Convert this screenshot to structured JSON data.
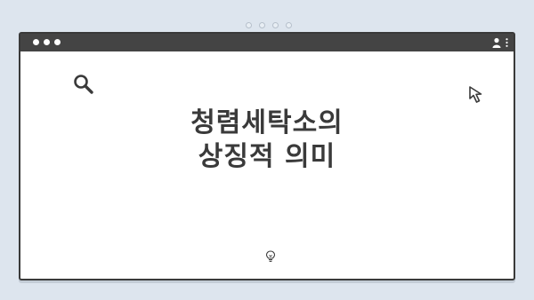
{
  "window": {
    "title_dots": 3,
    "icons": {
      "profile": "profile-icon",
      "menu": "more-vertical-icon",
      "search": "search-icon",
      "cursor": "cursor-arrow-icon",
      "bulb": "lightbulb-icon"
    }
  },
  "headline": {
    "line1": "청렴세탁소의",
    "line2": "상징적 의미"
  },
  "colors": {
    "background": "#dde5ee",
    "titlebar": "#444444",
    "window_bg": "#ffffff",
    "text": "#3a3a3a"
  }
}
